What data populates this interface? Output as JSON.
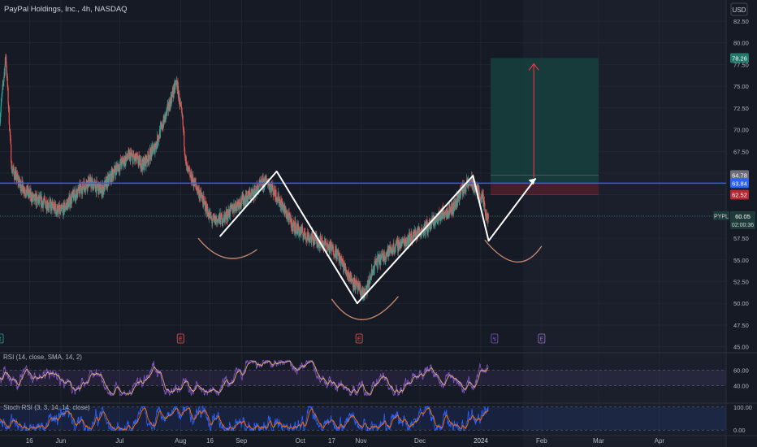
{
  "header": {
    "title": "PayPal Holdings, Inc., 4h, NASDAQ",
    "currency": "USD"
  },
  "colors": {
    "background": "#161a25",
    "grid": "#262a36",
    "forecast_bg": "#1b1f2b",
    "up": "#26a69a",
    "down": "#ef5350",
    "resistance": "#2962ff",
    "pattern": "#ffffff",
    "arc": "#c98b73",
    "target_zone": "#163f3d",
    "stop_zone": "#4a1f2b",
    "arrow": "#f23645",
    "rsi": "#7e57c2",
    "rsi_ma": "#e7b07d",
    "stoch_k": "#2962ff",
    "stoch_d": "#ff6d00"
  },
  "chart_data": {
    "type": "candlestick",
    "symbol": "PYPL",
    "y_axis": {
      "range": [
        44.5,
        84
      ],
      "ticks": [
        "82.50",
        "80.00",
        "77.50",
        "75.00",
        "72.50",
        "70.00",
        "67.50",
        "65.00",
        "62.50",
        "60.00",
        "57.50",
        "55.00",
        "52.50",
        "50.00",
        "47.50",
        "45.00"
      ]
    },
    "x_axis": {
      "range": [
        "2023-05-01",
        "2024-05-05"
      ],
      "ticks": [
        {
          "date": "2023-05-16",
          "label": "16"
        },
        {
          "date": "2023-06-01",
          "label": "Jun"
        },
        {
          "date": "2023-07-01",
          "label": "Jul"
        },
        {
          "date": "2023-08-01",
          "label": "Aug"
        },
        {
          "date": "2023-08-16",
          "label": "16"
        },
        {
          "date": "2023-09-01",
          "label": "Sep"
        },
        {
          "date": "2023-10-01",
          "label": "Oct"
        },
        {
          "date": "2023-10-17",
          "label": "17"
        },
        {
          "date": "2023-11-01",
          "label": "Nov"
        },
        {
          "date": "2023-12-01",
          "label": "Dec"
        },
        {
          "date": "2024-01-01",
          "label": "2024"
        },
        {
          "date": "2024-02-01",
          "label": "Feb"
        },
        {
          "date": "2024-03-01",
          "label": "Mar"
        },
        {
          "date": "2024-04-01",
          "label": "Apr"
        }
      ]
    },
    "price_path": [
      [
        "2023-05-01",
        71.5
      ],
      [
        "2023-05-04",
        78.5
      ],
      [
        "2023-05-07",
        65.5
      ],
      [
        "2023-05-11",
        63.8
      ],
      [
        "2023-05-18",
        62.0
      ],
      [
        "2023-05-25",
        61.5
      ],
      [
        "2023-06-01",
        60.5
      ],
      [
        "2023-06-08",
        62.5
      ],
      [
        "2023-06-15",
        64.0
      ],
      [
        "2023-06-22",
        63.0
      ],
      [
        "2023-06-29",
        65.5
      ],
      [
        "2023-07-06",
        67.0
      ],
      [
        "2023-07-13",
        66.0
      ],
      [
        "2023-07-19",
        68.0
      ],
      [
        "2023-07-25",
        72.0
      ],
      [
        "2023-07-30",
        75.5
      ],
      [
        "2023-08-02",
        71.0
      ],
      [
        "2023-08-04",
        65.5
      ],
      [
        "2023-08-10",
        63.0
      ],
      [
        "2023-08-17",
        59.5
      ],
      [
        "2023-08-23",
        59.8
      ],
      [
        "2023-08-30",
        61.5
      ],
      [
        "2023-09-06",
        62.5
      ],
      [
        "2023-09-14",
        64.2
      ],
      [
        "2023-09-20",
        62.0
      ],
      [
        "2023-09-27",
        59.0
      ],
      [
        "2023-10-04",
        57.8
      ],
      [
        "2023-10-12",
        57.0
      ],
      [
        "2023-10-19",
        56.0
      ],
      [
        "2023-10-25",
        53.5
      ],
      [
        "2023-10-31",
        51.5
      ],
      [
        "2023-11-03",
        51.0
      ],
      [
        "2023-11-08",
        54.5
      ],
      [
        "2023-11-15",
        56.0
      ],
      [
        "2023-11-22",
        57.0
      ],
      [
        "2023-11-29",
        58.0
      ],
      [
        "2023-12-06",
        59.0
      ],
      [
        "2023-12-13",
        60.5
      ],
      [
        "2023-12-18",
        61.0
      ],
      [
        "2023-12-22",
        63.0
      ],
      [
        "2023-12-27",
        64.0
      ],
      [
        "2024-01-02",
        62.0
      ],
      [
        "2024-01-04",
        59.5
      ],
      [
        "2024-01-05",
        60.05
      ]
    ],
    "last_price": {
      "label": "PYPL",
      "value": "60.05",
      "countdown": "02:00:36"
    },
    "resistance": {
      "value": 63.84,
      "label": "63.84"
    },
    "pattern_line": [
      [
        "2023-08-21",
        57.7
      ],
      [
        "2023-09-19",
        65.2
      ],
      [
        "2023-10-30",
        50.0
      ],
      [
        "2023-12-28",
        64.7
      ],
      [
        "2024-01-05",
        57.2
      ],
      [
        "2024-01-29",
        64.4
      ]
    ],
    "position": {
      "type": "long",
      "entry": 63.84,
      "entry_label": "63.84",
      "target": 78.26,
      "target_label": "78.26",
      "stop": 62.52,
      "stop_label": "62.52",
      "entry_alt": "64.78",
      "start": "2024-01-06",
      "end": "2024-03-01"
    },
    "arrow": {
      "date": "2024-01-28",
      "from": 64.5,
      "to": 77.6
    },
    "event_markers": [
      {
        "date": "2023-05-01",
        "label": "↥"
      },
      {
        "date": "2023-08-01",
        "label": "E"
      },
      {
        "date": "2023-10-31",
        "label": "E"
      },
      {
        "date": "2024-01-08",
        "label": "↯"
      },
      {
        "date": "2024-02-01",
        "label": "E"
      }
    ],
    "indicators": [
      {
        "name": "RSI",
        "label": "RSI (14, close, SMA, 14, 2)",
        "levels": [
          "60.00",
          "40.00"
        ],
        "range": [
          20,
          80
        ]
      },
      {
        "name": "Stoch RSI",
        "label": "Stoch RSI (3, 3, 14, 14, close)",
        "levels": [
          "100.00",
          "0.00"
        ],
        "range": [
          -10,
          110
        ]
      }
    ]
  }
}
